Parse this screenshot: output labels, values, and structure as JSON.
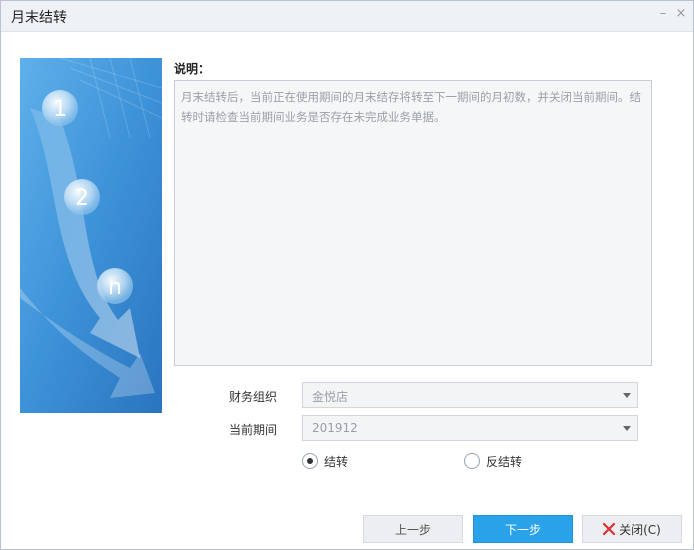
{
  "window": {
    "title": "月末结转",
    "minimize_glyph": "–",
    "close_glyph": "×"
  },
  "description": {
    "label": "说明：",
    "text": "月末结转后，当前正在使用期间的月末结存将转至下一期间的月初数，并关闭当前期间。结转时请检查当前期间业务是否存在未完成业务单据。"
  },
  "form": {
    "org_label": "财务组织",
    "org_value": "金悦店",
    "period_label": "当前期间",
    "period_value": "201912"
  },
  "options": {
    "carry_label": "结转",
    "reverse_label": "反结转",
    "selected": "carry"
  },
  "buttons": {
    "prev_label": "上一步",
    "next_label": "下一步",
    "close_label": "关闭(C)"
  },
  "banner": {
    "steps": [
      "1",
      "2",
      "n"
    ]
  },
  "colors": {
    "accent": "#2aa2ea",
    "banner_dark": "#2a7fc7",
    "banner_light": "#6fb8ec",
    "close_x": "#e03030"
  }
}
